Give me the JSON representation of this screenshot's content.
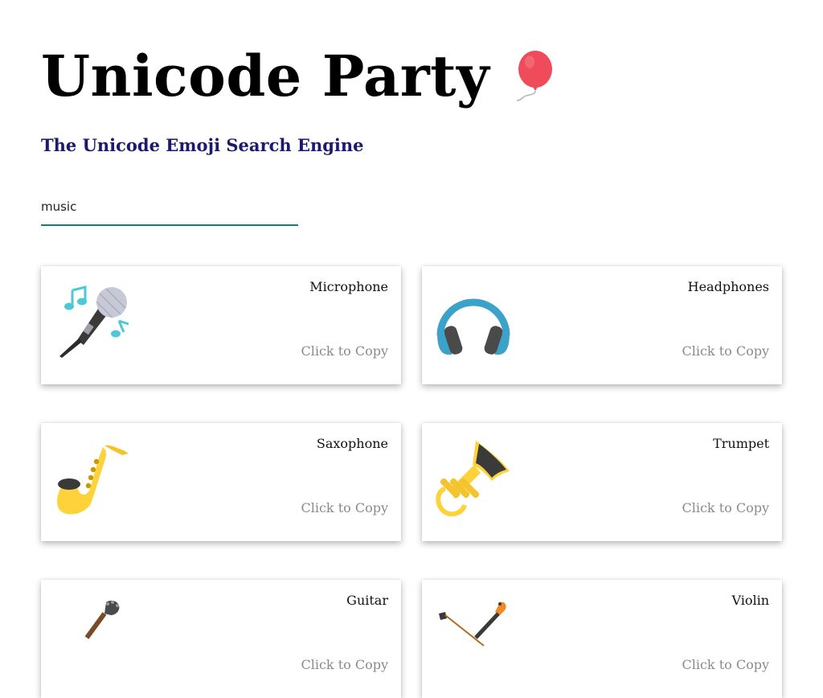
{
  "header": {
    "title": "Unicode Party",
    "title_icon": "balloon-icon",
    "subtitle": "The Unicode Emoji Search Engine"
  },
  "search": {
    "value": "music",
    "placeholder": ""
  },
  "colors": {
    "subtitle": "#1a1a6e",
    "search_underline": "#137f7c",
    "copy_text": "#8a8a8a",
    "balloon": "#ef4b5a"
  },
  "results": [
    {
      "name": "Microphone",
      "copy_label": "Click to Copy",
      "icon": "microphone-icon"
    },
    {
      "name": "Headphones",
      "copy_label": "Click to Copy",
      "icon": "headphones-icon"
    },
    {
      "name": "Saxophone",
      "copy_label": "Click to Copy",
      "icon": "saxophone-icon"
    },
    {
      "name": "Trumpet",
      "copy_label": "Click to Copy",
      "icon": "trumpet-icon"
    },
    {
      "name": "Guitar",
      "copy_label": "Click to Copy",
      "icon": "guitar-icon"
    },
    {
      "name": "Violin",
      "copy_label": "Click to Copy",
      "icon": "violin-icon"
    }
  ]
}
